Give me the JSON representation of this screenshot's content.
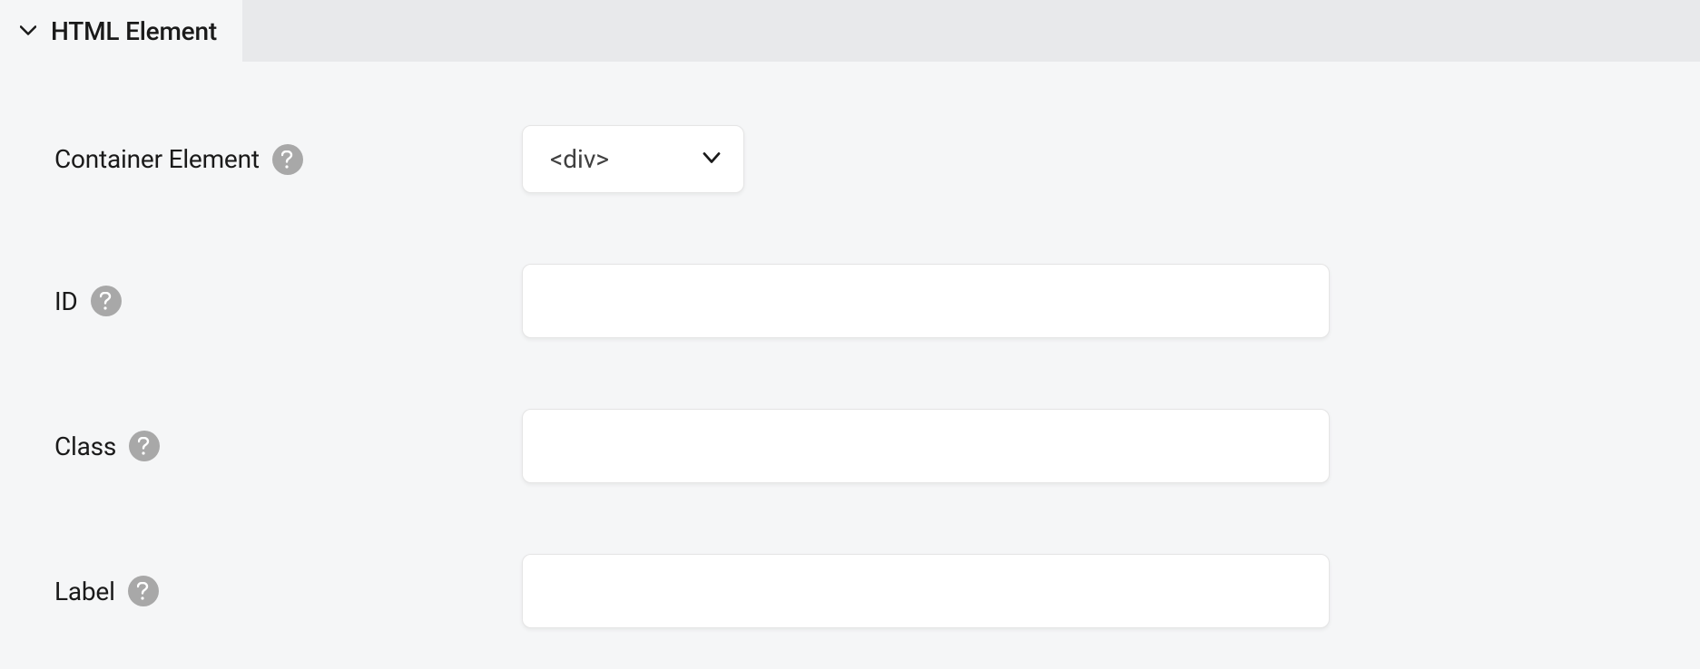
{
  "panel": {
    "title": "HTML Element"
  },
  "fields": {
    "containerElement": {
      "label": "Container Element",
      "selected": "<div>"
    },
    "id": {
      "label": "ID",
      "value": ""
    },
    "class": {
      "label": "Class",
      "value": ""
    },
    "label": {
      "label": "Label",
      "value": ""
    }
  }
}
